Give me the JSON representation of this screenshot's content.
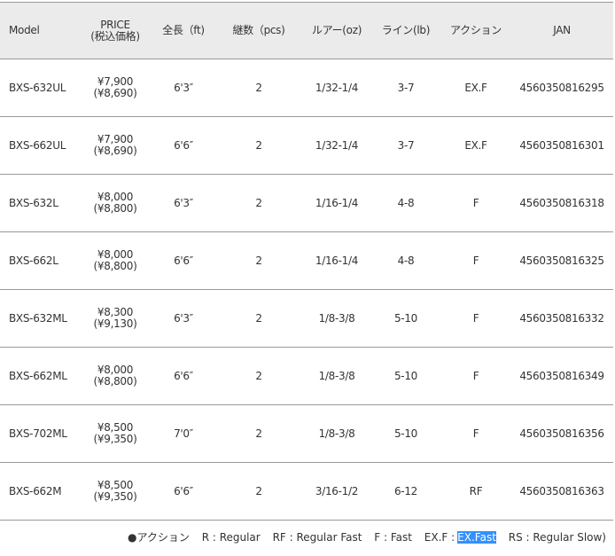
{
  "headers": {
    "model": "Model",
    "price1": "PRICE",
    "price2": "(税込価格)",
    "length": "全長（ft)",
    "pieces": "継数（pcs)",
    "lure": "ルアー(oz)",
    "line": "ライン(lb)",
    "action": "アクション",
    "jan": "JAN"
  },
  "rows": [
    {
      "model": "BXS-632UL",
      "price": "¥7,900",
      "price_tax": "(¥8,690)",
      "length": "6'3″",
      "pieces": "2",
      "lure": "1/32-1/4",
      "line": "3-7",
      "action": "EX.F",
      "jan": "4560350816295"
    },
    {
      "model": "BXS-662UL",
      "price": "¥7,900",
      "price_tax": "(¥8,690)",
      "length": "6'6″",
      "pieces": "2",
      "lure": "1/32-1/4",
      "line": "3-7",
      "action": "EX.F",
      "jan": "4560350816301"
    },
    {
      "model": "BXS-632L",
      "price": "¥8,000",
      "price_tax": "(¥8,800)",
      "length": "6'3″",
      "pieces": "2",
      "lure": "1/16-1/4",
      "line": "4-8",
      "action": "F",
      "jan": "4560350816318"
    },
    {
      "model": "BXS-662L",
      "price": "¥8,000",
      "price_tax": "(¥8,800)",
      "length": "6'6″",
      "pieces": "2",
      "lure": "1/16-1/4",
      "line": "4-8",
      "action": "F",
      "jan": "4560350816325"
    },
    {
      "model": "BXS-632ML",
      "price": "¥8,300",
      "price_tax": "(¥9,130)",
      "length": "6'3″",
      "pieces": "2",
      "lure": "1/8-3/8",
      "line": "5-10",
      "action": "F",
      "jan": "4560350816332"
    },
    {
      "model": "BXS-662ML",
      "price": "¥8,000",
      "price_tax": "(¥8,800)",
      "length": "6'6″",
      "pieces": "2",
      "lure": "1/8-3/8",
      "line": "5-10",
      "action": "F",
      "jan": "4560350816349"
    },
    {
      "model": "BXS-702ML",
      "price": "¥8,500",
      "price_tax": "(¥9,350)",
      "length": "7'0″",
      "pieces": "2",
      "lure": "1/8-3/8",
      "line": "5-10",
      "action": "F",
      "jan": "4560350816356"
    },
    {
      "model": "BXS-662M",
      "price": "¥8,500",
      "price_tax": "(¥9,350)",
      "length": "6'6″",
      "pieces": "2",
      "lure": "3/16-1/2",
      "line": "6-12",
      "action": "RF",
      "jan": "4560350816363"
    }
  ],
  "legend": {
    "title": "●アクション",
    "r": "R : Regular",
    "rf": "RF : Regular Fast",
    "f": "F : Fast",
    "exf_prefix": "EX.F :",
    "exf_value": "EX.Fast",
    "rs": "RS : Regular Slow)"
  }
}
